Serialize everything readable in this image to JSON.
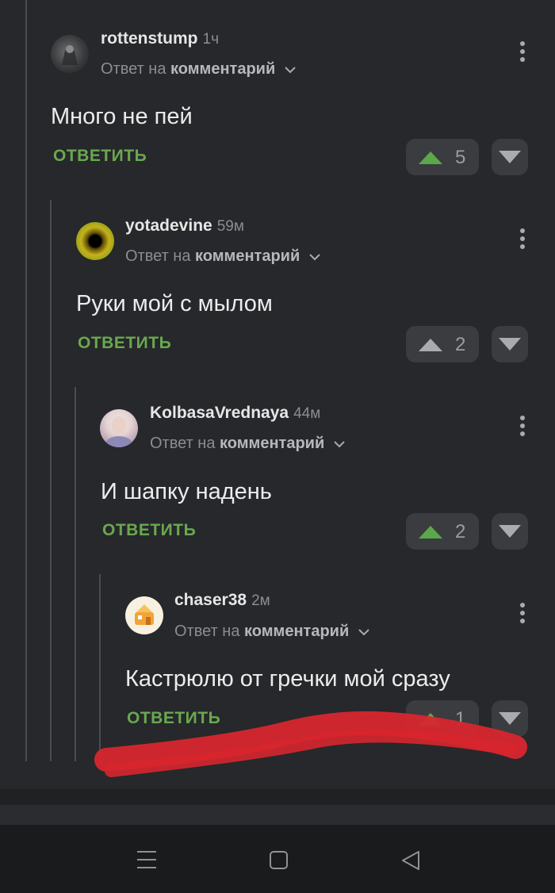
{
  "comments": [
    {
      "author": "rottenstump",
      "time": "1ч",
      "reply_prefix": "Ответ на",
      "reply_target": "комментарий",
      "text": "Много не пей",
      "reply_label": "ОТВЕТИТЬ",
      "votes": "5"
    },
    {
      "author": "yotadevine",
      "time": "59м",
      "reply_prefix": "Ответ на",
      "reply_target": "комментарий",
      "text": "Руки мой с мылом",
      "reply_label": "ОТВЕТИТЬ",
      "votes": "2"
    },
    {
      "author": "KolbasaVrednaya",
      "time": "44м",
      "reply_prefix": "Ответ на",
      "reply_target": "комментарий",
      "text": "И шапку надень",
      "reply_label": "ОТВЕТИТЬ",
      "votes": "2"
    },
    {
      "author": "chaser38",
      "time": "2м",
      "reply_prefix": "Ответ на",
      "reply_target": "комментарий",
      "text": "Кастрюлю от гречки мой сразу",
      "reply_label": "ОТВЕТИТЬ",
      "votes": "1"
    }
  ],
  "colors": {
    "background": "#26282b",
    "reply_green": "#6aa84f",
    "upvote_green": "#5aa84a",
    "scribble_red": "#d7262e"
  },
  "icons": {
    "upvote": "triangle-up-icon",
    "downvote": "triangle-down-icon",
    "more": "kebab-menu-icon",
    "nav_menu": "menu-icon",
    "nav_home": "home-square-icon",
    "nav_back": "back-triangle-icon"
  }
}
